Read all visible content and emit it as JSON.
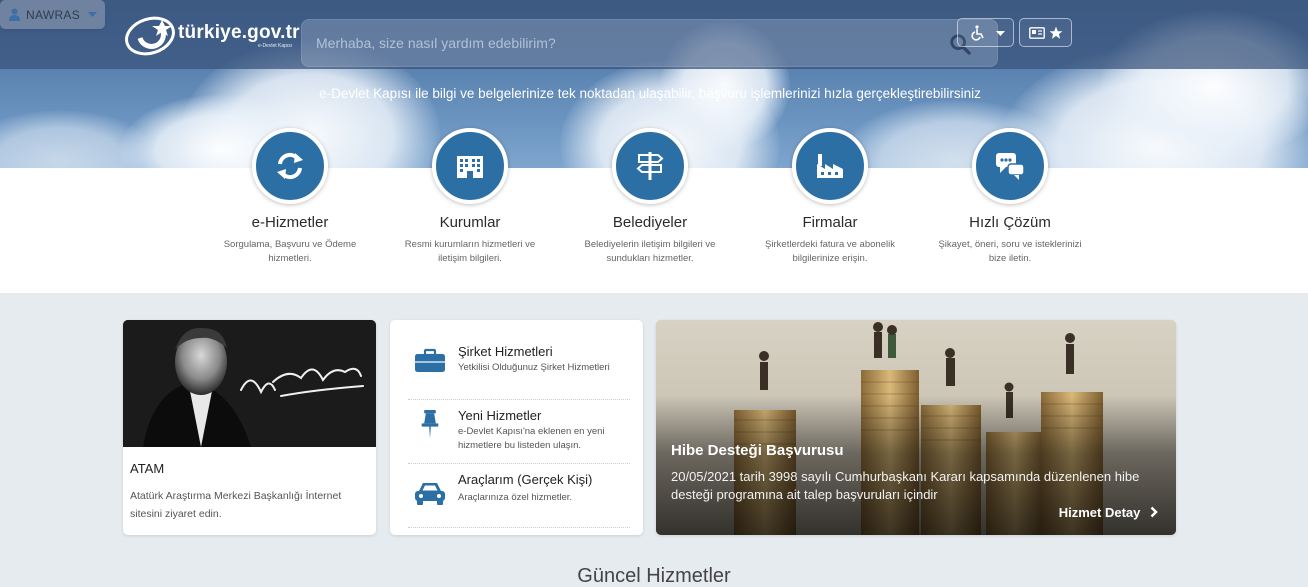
{
  "header": {
    "logo_text": "türkiye.gov.tr",
    "logo_sub": "e-Devlet Kapısı",
    "search_placeholder": "Merhaba, size nasıl yardım edebilirim?",
    "user_name": "NAWRAS",
    "tagline": "e-Devlet Kapısı ile bilgi ve belgelerinize tek noktadan ulaşabilir, başvuru işlemlerinizi hızla gerçekleştirebilirsiniz"
  },
  "services": [
    {
      "icon": "refresh-icon",
      "title": "e-Hizmetler",
      "desc": "Sorgulama, Başvuru ve Ödeme hizmetleri."
    },
    {
      "icon": "building-icon",
      "title": "Kurumlar",
      "desc": "Resmi kurumların hizmetleri ve iletişim bilgileri."
    },
    {
      "icon": "signpost-icon",
      "title": "Belediyeler",
      "desc": "Belediyelerin iletişim bilgileri ve sundukları hizmetler."
    },
    {
      "icon": "factory-icon",
      "title": "Firmalar",
      "desc": "Şirketlerdeki fatura ve abonelik bilgilerinize erişin."
    },
    {
      "icon": "chat-icon",
      "title": "Hızlı Çözüm",
      "desc": "Şikayet, öneri, soru ve isteklerinizi bize iletin."
    }
  ],
  "atam": {
    "title": "ATAM",
    "desc": "Atatürk Araştırma Merkezi Başkanlığı İnternet sitesini ziyaret edin."
  },
  "links": [
    {
      "icon": "briefcase-icon",
      "title": "Şirket Hizmetleri",
      "desc": "Yetkilisi Olduğunuz Şirket Hizmetleri"
    },
    {
      "icon": "pin-icon",
      "title": "Yeni Hizmetler",
      "desc": "e-Devlet Kapısı'na eklenen en yeni hizmetlere bu listeden ulaşın."
    },
    {
      "icon": "car-icon",
      "title": "Araçlarım (Gerçek Kişi)",
      "desc": "Araçlarınıza özel hizmetler."
    }
  ],
  "featured": {
    "title": "Hibe Desteği Başvurusu",
    "desc": "20/05/2021 tarih 3998 sayılı Cumhurbaşkanı Kararı kapsamında düzenlenen hibe desteği programına ait talep başvuruları içindir",
    "link": "Hizmet Detay"
  },
  "section_title": "Güncel Hizmetler",
  "colors": {
    "primary": "#2c6fa5",
    "header": "#37527a",
    "background": "#e6ebf0"
  }
}
